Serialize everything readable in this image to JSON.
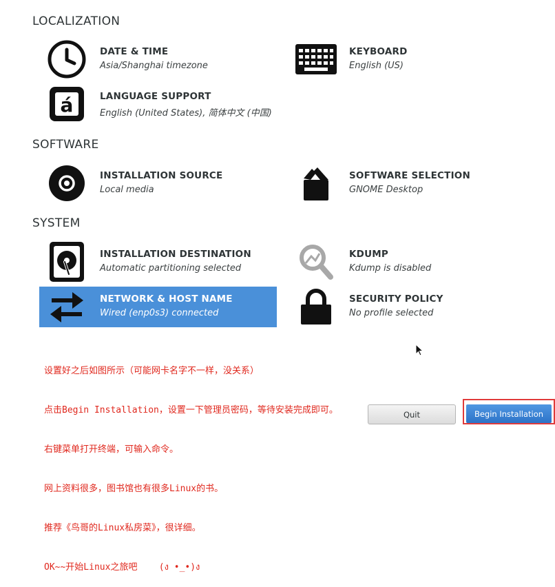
{
  "sections": {
    "localization": "LOCALIZATION",
    "software": "SOFTWARE",
    "system": "SYSTEM"
  },
  "spokes": {
    "datetime": {
      "title": "DATE & TIME",
      "status": "Asia/Shanghai timezone",
      "icon": "clock-icon"
    },
    "keyboard": {
      "title": "KEYBOARD",
      "status": "English (US)",
      "icon": "keyboard-icon"
    },
    "language": {
      "title": "LANGUAGE SUPPORT",
      "status": "English (United States), 简体中文 (中国)",
      "icon": "language-icon"
    },
    "source": {
      "title": "INSTALLATION SOURCE",
      "status": "Local media",
      "icon": "disc-icon"
    },
    "software": {
      "title": "SOFTWARE SELECTION",
      "status": "GNOME Desktop",
      "icon": "package-icon"
    },
    "destination": {
      "title": "INSTALLATION DESTINATION",
      "status": "Automatic partitioning selected",
      "icon": "harddisk-icon"
    },
    "kdump": {
      "title": "KDUMP",
      "status": "Kdump is disabled",
      "icon": "magnifier-icon"
    },
    "network": {
      "title": "NETWORK & HOST NAME",
      "status": "Wired (enp0s3) connected",
      "icon": "network-arrows-icon"
    },
    "security": {
      "title": "SECURITY POLICY",
      "status": "No profile selected",
      "icon": "padlock-icon"
    }
  },
  "note_lines": [
    "设置好之后如图所示（可能网卡名字不一样，没关系）",
    "点击Begin Installation，设置一下管理员密码，等待安装完成即可。",
    "右键菜单打开终端，可输入命令。",
    "网上资料很多，图书馆也有很多Linux的书。",
    "推荐《鸟哥的Linux私房菜》，很详细。",
    "OK~~开始Linux之旅吧    (ง •_•)ง"
  ],
  "buttons": {
    "quit": "Quit",
    "begin": "Begin Installation"
  },
  "colors": {
    "selected": "#4a90d9",
    "note": "#e0281e",
    "highlight_border": "#e03a3a"
  }
}
